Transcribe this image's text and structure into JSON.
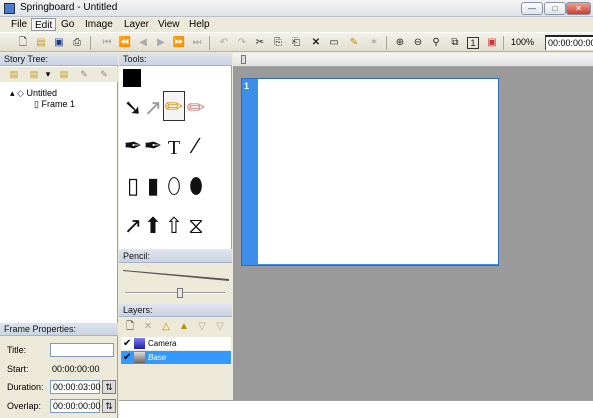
{
  "window": {
    "title": "Springboard - Untitled",
    "min": "—",
    "max": "□",
    "close": "✕"
  },
  "menu": [
    "File",
    "Edit",
    "Go",
    "Image",
    "Layer",
    "View",
    "Help"
  ],
  "toolbar": {
    "zoom": "100%",
    "timecode": "00:00:00:00"
  },
  "story_tree": {
    "header": "Story Tree:",
    "root": "Untitled",
    "child": "Frame 1"
  },
  "frame_properties": {
    "header": "Frame Properties:",
    "title_label": "Title:",
    "title_value": "",
    "start_label": "Start:",
    "start_value": "00:00:00:00",
    "duration_label": "Duration:",
    "duration_value": "00:00:03:00",
    "overlap_label": "Overlap:",
    "overlap_value": "00:00:00:00"
  },
  "tools": {
    "header": "Tools:",
    "colors": {
      "foreground": "#000000",
      "background": "#ffffff"
    },
    "text_tool": "T"
  },
  "pencil": {
    "header": "Pencil:",
    "size_fraction": 0.55
  },
  "layers": {
    "header": "Layers:",
    "items": [
      {
        "name": "Camera",
        "selected": false
      },
      {
        "name": "Base",
        "selected": true
      }
    ],
    "selection_color": "#3399ff"
  },
  "stage": {
    "frame_number": "1",
    "frame_color": "#3c8ee8"
  }
}
